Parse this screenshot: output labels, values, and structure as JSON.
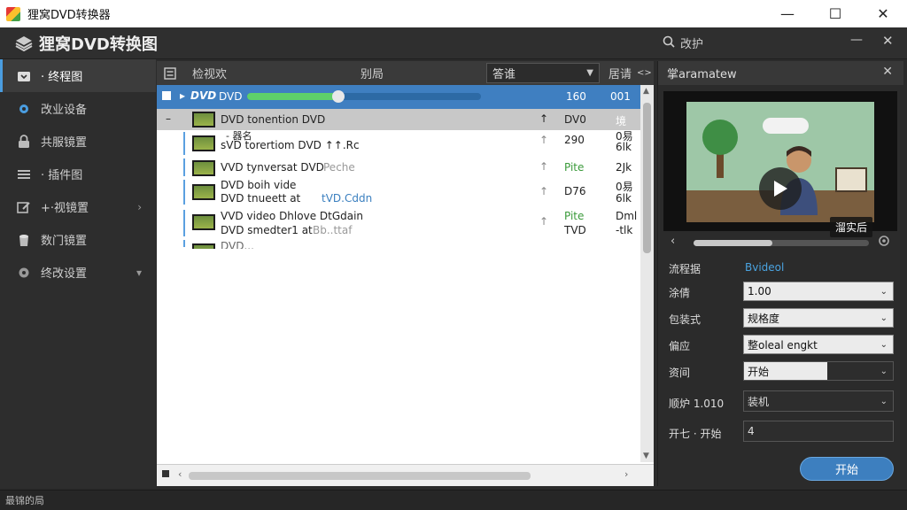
{
  "window": {
    "title": "狸窝DVD转换器",
    "minimize": "—",
    "maximize": "☐",
    "close": "✕"
  },
  "app": {
    "title": "狸窝DVD转换图",
    "search_label": "改护",
    "min": "—",
    "close": "✕"
  },
  "sidebar": {
    "items": [
      {
        "label": "· 终程图"
      },
      {
        "label": "改业设备"
      },
      {
        "label": "共服镜置"
      },
      {
        "label": "· 插件图"
      },
      {
        "label": "+·视镜置"
      },
      {
        "label": "数门镜置"
      },
      {
        "label": "终改设置"
      }
    ]
  },
  "list": {
    "header": {
      "col1": "检视欢",
      "col2": "别局",
      "dropdown": "答谁",
      "col4": "居请",
      "arrows": "<>"
    },
    "selected_row": {
      "name": "DVD",
      "logo": "DVD",
      "size": "160",
      "code": "001",
      "progress": 0.39
    },
    "rows": [
      {
        "line1": "DVD tonention DVD",
        "line2": "",
        "col3": "DV0",
        "col4": "境"
      },
      {
        "line1": "- 器名",
        "line2": "sVD torertiom DVD ↑↑.Rc",
        "col3": "290",
        "col4": "0易",
        "col4b": "6lk"
      },
      {
        "line1": "VVD tynversat DVD",
        "line2": "Peche",
        "col3": "Pite",
        "col4": "2Jk"
      },
      {
        "line1": "DVD boih vide",
        "line2": "DVD tnueett at",
        "line2b": "tVD.Cddn",
        "col3": "D76",
        "col4": "0易",
        "col4b": "6lk"
      },
      {
        "line1": "VVD video Dhlove DtGdain",
        "line2": "DVD smedter1 at",
        "line2b": "Bb..ttaf",
        "col3": "Pite",
        "col3b": "TVD",
        "col4": "Dml",
        "col4b": "-tlk"
      },
      {
        "line1": "DVD...",
        "line2": "",
        "col3": "",
        "col4": ""
      }
    ]
  },
  "preview": {
    "header": "掌aramatew",
    "badge": "溜实后",
    "seek_progress": 0.45
  },
  "props": {
    "title_label": "流程据",
    "title_value": "Bvideol",
    "rows": [
      {
        "label": "涂倩",
        "value": "1.00"
      },
      {
        "label": "包装式",
        "value": "规格度"
      },
      {
        "label": "偏应",
        "value": "整oleal engkt"
      },
      {
        "label": "资间",
        "value": "开始"
      },
      {
        "label": "顺炉 1.010",
        "value": "装机"
      },
      {
        "label": "开七 · 开始",
        "value": "4"
      }
    ],
    "start_button": "开始"
  },
  "status": {
    "text": "最锦的局"
  }
}
